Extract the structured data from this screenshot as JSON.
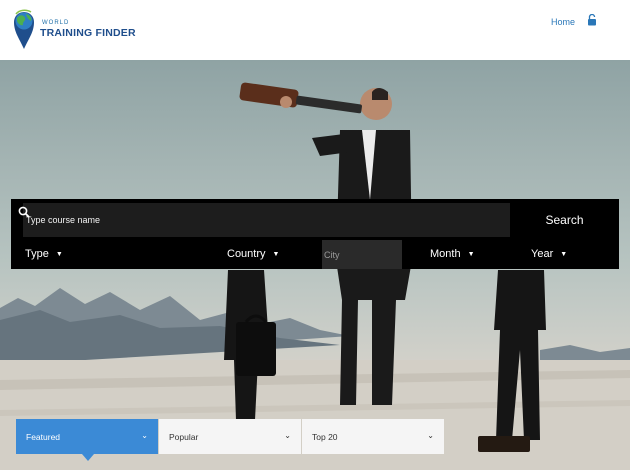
{
  "header": {
    "logo_small": "WORLD",
    "logo_big": "TRAINING FINDER",
    "nav_home": "Home",
    "lock_icon": "lock-open-icon"
  },
  "search": {
    "placeholder": "Type course name",
    "button_label": "Search",
    "icon": "search-icon"
  },
  "filters": {
    "type": "Type",
    "country": "Country",
    "city_placeholder": "City",
    "month": "Month",
    "year": "Year"
  },
  "tabs": [
    {
      "label": "Featured",
      "active": true
    },
    {
      "label": "Popular",
      "active": false
    },
    {
      "label": "Top 20",
      "active": false
    }
  ],
  "colors": {
    "brand_blue": "#1f4e8c",
    "link_blue": "#2a77b8",
    "active_tab": "#3b8ad6",
    "logo_green": "#4caf50"
  }
}
